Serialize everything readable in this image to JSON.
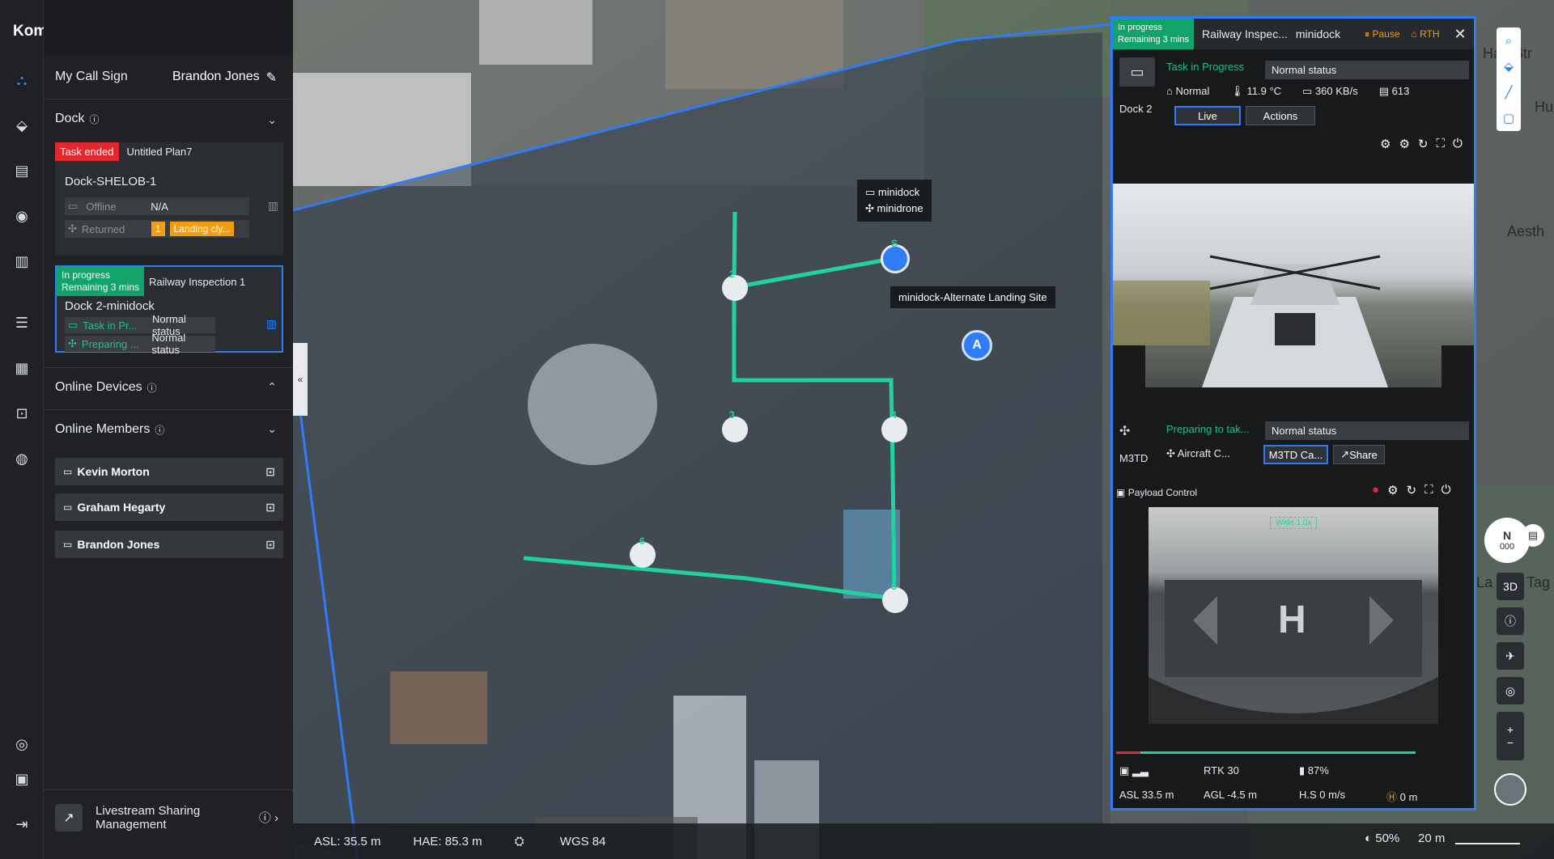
{
  "app": {
    "brand": "Komatsu"
  },
  "rail_icons": [
    "flight-hub-icon",
    "map-pin-icon",
    "media-icon",
    "device-icon",
    "models-icon",
    "tasks-icon",
    "calendar-icon",
    "photos-icon",
    "globe-icon",
    "help-icon",
    "logs-icon",
    "logout-icon"
  ],
  "panel": {
    "call_sign_label": "My Call Sign",
    "call_sign_value": "Brandon Jones",
    "dock_title": "Dock",
    "dock1": {
      "badge": "Task ended",
      "plan": "Untitled Plan7",
      "name": "Dock-SHELOB-1",
      "row1_label": "Offline",
      "row1_value": "N/A",
      "row2_label": "Returned",
      "row2_num": "1",
      "row2_status": "Landing cly..."
    },
    "dock2": {
      "badge_line1": "In progress",
      "badge_line2": "Remaining 3 mins",
      "plan": "Railway Inspection 1",
      "name": "Dock 2-minidock",
      "row1_label": "Task in Pr...",
      "row1_value": "Normal status",
      "row2_label": "Preparing ...",
      "row2_value": "Normal status"
    },
    "online_devices": "Online Devices",
    "online_members": "Online Members",
    "members": [
      "Kevin Morton",
      "Graham Hegarty",
      "Brandon Jones"
    ],
    "livestream_line1": "Livestream Sharing",
    "livestream_line2": "Management"
  },
  "map": {
    "tooltip_dock": "minidock",
    "tooltip_drone": "minidrone",
    "alt_landing": "minidock-Alternate Landing Site",
    "waypoints": [
      "S",
      "2",
      "3",
      "4",
      "5",
      "6"
    ],
    "place_labels": [
      "Han Str",
      "Hur",
      "Aesth",
      "La",
      "Tag"
    ]
  },
  "statusbar": {
    "asl": "ASL: 35.5 m",
    "hae": "HAE: 85.3 m",
    "wgs": "WGS 84",
    "zoom": "50%",
    "scale": "20 m"
  },
  "task": {
    "badge_line1": "In progress",
    "badge_line2": "Remaining 3 mins",
    "title": "Railway Inspec...",
    "device": "minidock",
    "pause": "Pause",
    "rth": "RTH",
    "dock_name": "Dock 2",
    "dock_state": "Task in Progress",
    "dock_status": "Normal status",
    "network": "Normal",
    "temp": "11.9 °C",
    "speed": "360 KB/s",
    "storage": "613",
    "live": "Live",
    "actions": "Actions",
    "aircraft_name": "M3TD",
    "aircraft_state": "Preparing to tak...",
    "aircraft_status": "Normal status",
    "aircraft_cam": "Aircraft C...",
    "m3td_cam": "M3TD Ca...",
    "share": "Share",
    "payload": "Payload Control",
    "wide": "Wide 1.0x",
    "rtk": "RTK 30",
    "battery": "87%",
    "asl": "ASL 33.5 m",
    "agl": "AGL -4.5 m",
    "hs": "H.S 0 m/s",
    "home": "0 m"
  },
  "compass": {
    "dir": "N",
    "deg": "000"
  },
  "map_tools": {
    "mode": "3D"
  },
  "colors": {
    "accent": "#2f7df6",
    "route": "#1fd3a0",
    "danger": "#e0282e",
    "success": "#12a36a",
    "warning": "#f29d12"
  }
}
